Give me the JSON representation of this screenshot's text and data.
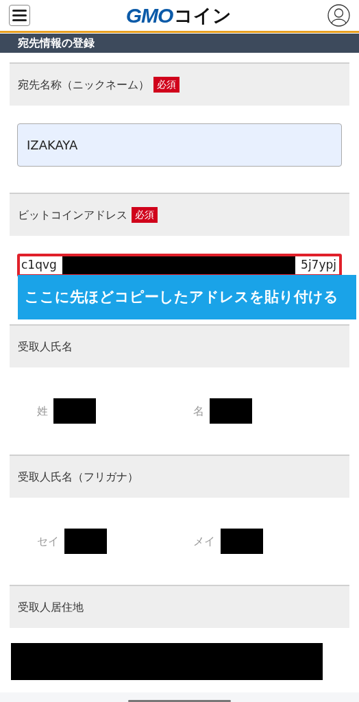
{
  "header": {
    "logo_latin": "GMO",
    "logo_kana": "コイン"
  },
  "page_title": "宛先情報の登録",
  "sections": [
    {
      "label": "宛先名称（ニックネーム）",
      "badge": "必須",
      "kind": "text_input",
      "value": "IZAKAYA"
    },
    {
      "label": "ビットコインアドレス",
      "badge": "必須",
      "kind": "address_input",
      "value_start": "c1qvg",
      "value_end": "5j7ypj",
      "callout": "ここに先ほどコピーしたアドレスを貼り付ける"
    },
    {
      "label": "受取人氏名",
      "kind": "name_pair",
      "fields": [
        {
          "label": "姓"
        },
        {
          "label": "名"
        }
      ]
    },
    {
      "label": "受取人氏名（フリガナ）",
      "kind": "name_pair",
      "fields": [
        {
          "label": "セイ"
        },
        {
          "label": "メイ"
        }
      ]
    },
    {
      "label": "受取人居住地",
      "kind": "redacted"
    }
  ]
}
